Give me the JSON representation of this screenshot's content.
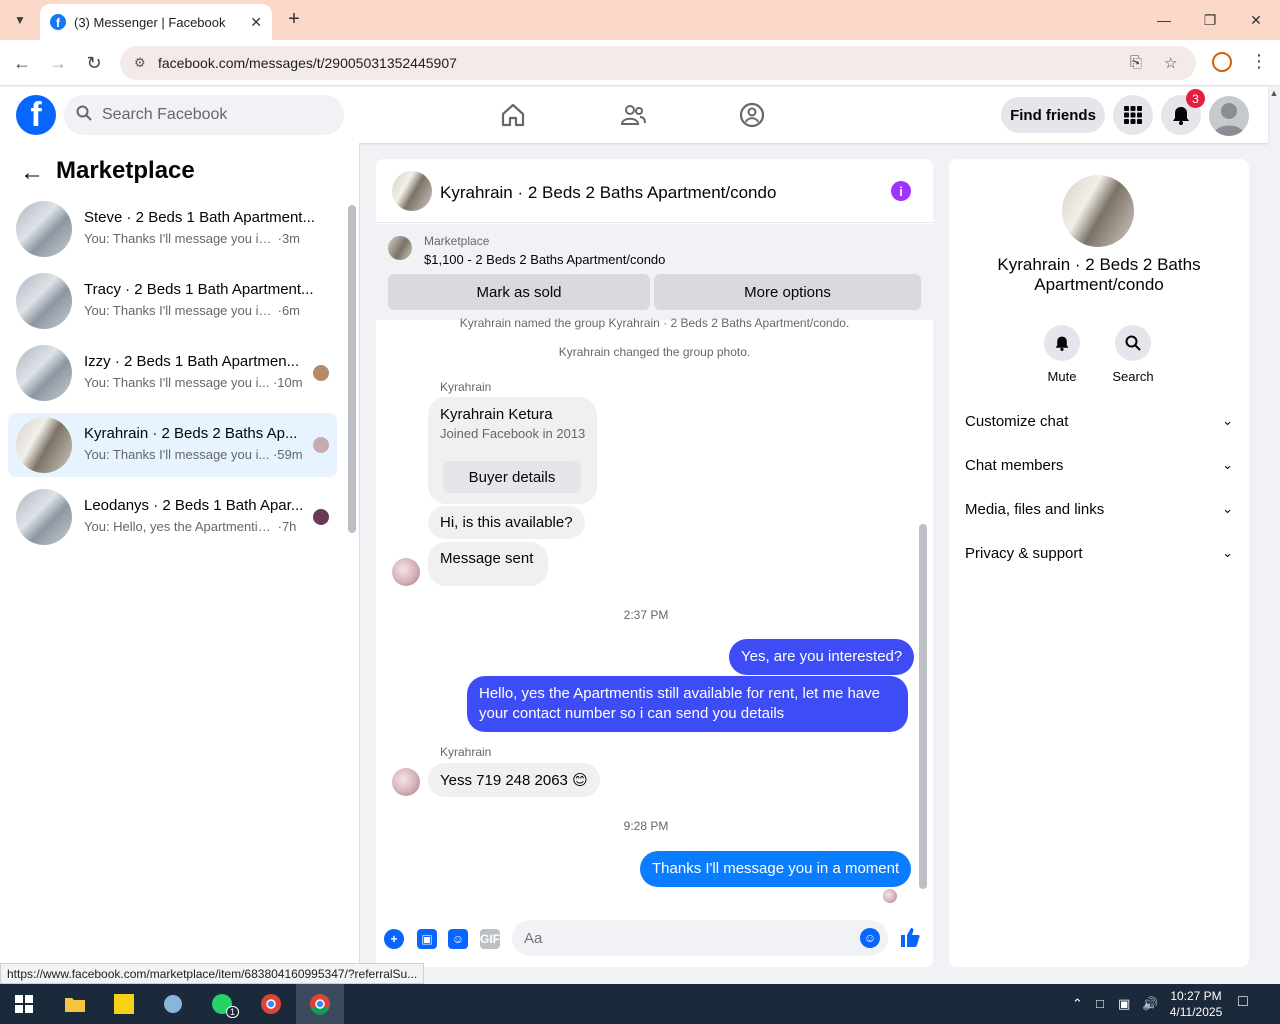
{
  "browser": {
    "tab_title": "(3) Messenger | Facebook",
    "url": "facebook.com/messages/t/29005031352445907",
    "status_url": "https://www.facebook.com/marketplace/item/683804160995347/?referralSu..."
  },
  "fb_header": {
    "search_placeholder": "Search Facebook",
    "find_friends": "Find friends",
    "notification_count": "3"
  },
  "sidebar": {
    "title": "Marketplace",
    "conversations": [
      {
        "name": "Steve · 2 Beds 1 Bath Apartment...",
        "preview": "You: Thanks I'll message you in a ...",
        "time": "·3m"
      },
      {
        "name": "Tracy · 2 Beds 1 Bath Apartment...",
        "preview": "You: Thanks I'll message you in a ...",
        "time": "·6m"
      },
      {
        "name": "Izzy · 2 Beds 1 Bath Apartmen...",
        "preview": "You: Thanks I'll message you i...",
        "time": "·10m"
      },
      {
        "name": "Kyrahrain · 2 Beds 2 Baths Ap...",
        "preview": "You: Thanks I'll message you i...",
        "time": "·59m"
      },
      {
        "name": "Leodanys · 2 Beds 1 Bath Apar...",
        "preview": "You: Hello, yes the Apartmentis s...",
        "time": "·7h"
      }
    ]
  },
  "chat": {
    "title": "Kyrahrain · 2 Beds 2 Baths Apartment/condo",
    "marketplace_label": "Marketplace",
    "listing": "$1,100 - 2 Beds 2 Baths Apartment/condo",
    "mark_sold": "Mark as sold",
    "more_options": "More options",
    "sys1": "Kyrahrain named the group Kyrahrain · 2 Beds 2 Baths Apartment/condo.",
    "sys2": "Kyrahrain changed the group photo.",
    "sender": "Kyrahrain",
    "card_name": "Kyrahrain Ketura",
    "card_sub": "Joined Facebook in 2013",
    "buyer_details": "Buyer details",
    "msg1": "Hi, is this available?",
    "msg2": "Message sent",
    "time1": "2:37 PM",
    "out1": "Yes, are you interested?",
    "out2": "Hello, yes the Apartmentis still available for rent, let me have your contact number so i can send you  details",
    "msg3": "Yess 719 248 2063 😊",
    "time2": "9:28 PM",
    "out3": "Thanks I'll message you in a moment",
    "composer_placeholder": "Aa"
  },
  "right_panel": {
    "name": "Kyrahrain · 2 Beds 2 Baths Apartment/condo",
    "mute": "Mute",
    "search": "Search",
    "rows": [
      "Customize chat",
      "Chat members",
      "Media, files and links",
      "Privacy & support"
    ]
  },
  "taskbar": {
    "time": "10:27 PM",
    "date": "4/11/2025",
    "whatsapp_badge": "1"
  },
  "colors": {
    "fb_blue": "#0866ff",
    "outgoing_bubble": "#3d4cf5",
    "active_conversation": "#e7f3ff",
    "info_purple": "#a033ff"
  }
}
